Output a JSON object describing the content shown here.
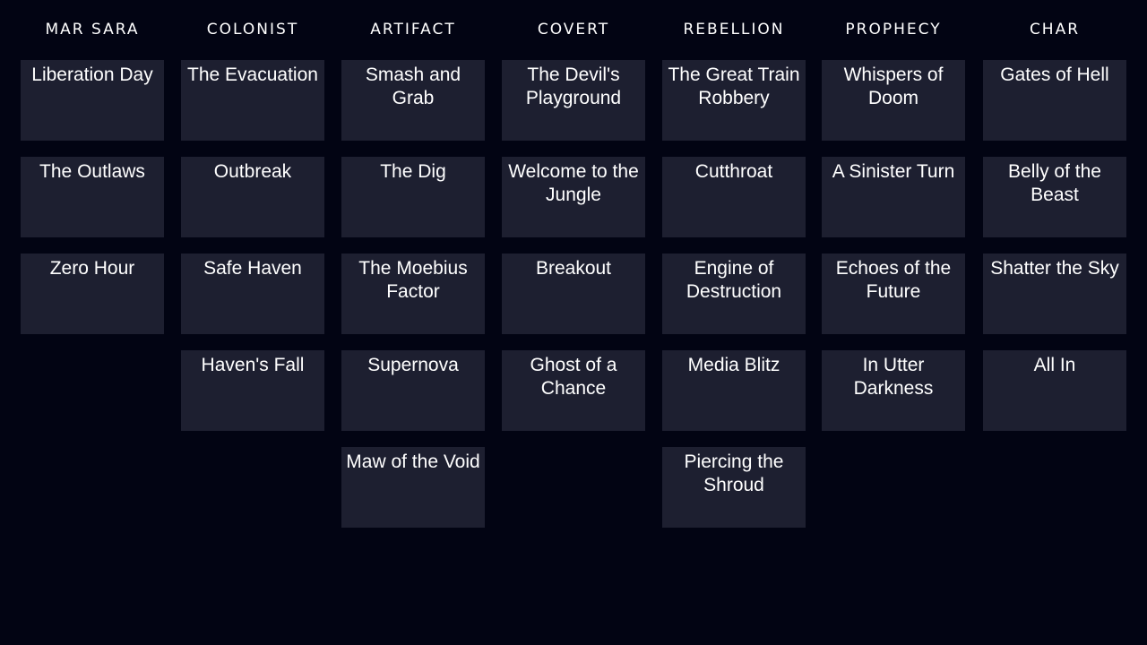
{
  "columns": [
    {
      "name": "MAR SARA",
      "missions": [
        "Liberation Day",
        "The Outlaws",
        "Zero Hour"
      ]
    },
    {
      "name": "COLONIST",
      "missions": [
        "The Evacuation",
        "Outbreak",
        "Safe Haven",
        "Haven's Fall"
      ]
    },
    {
      "name": "ARTIFACT",
      "missions": [
        "Smash and Grab",
        "The Dig",
        "The Moebius Factor",
        "Supernova",
        "Maw of the Void"
      ]
    },
    {
      "name": "COVERT",
      "missions": [
        "The Devil's Playground",
        "Welcome to the Jungle",
        "Breakout",
        "Ghost of a Chance"
      ]
    },
    {
      "name": "REBELLION",
      "missions": [
        "The Great Train Robbery",
        "Cutthroat",
        "Engine of Destruction",
        "Media Blitz",
        "Piercing the Shroud"
      ]
    },
    {
      "name": "PROPHECY",
      "missions": [
        "Whispers of Doom",
        "A Sinister Turn",
        "Echoes of the Future",
        "In Utter Darkness"
      ]
    },
    {
      "name": "CHAR",
      "missions": [
        "Gates of Hell",
        "Belly of the Beast",
        "Shatter the Sky",
        "All In"
      ]
    }
  ]
}
